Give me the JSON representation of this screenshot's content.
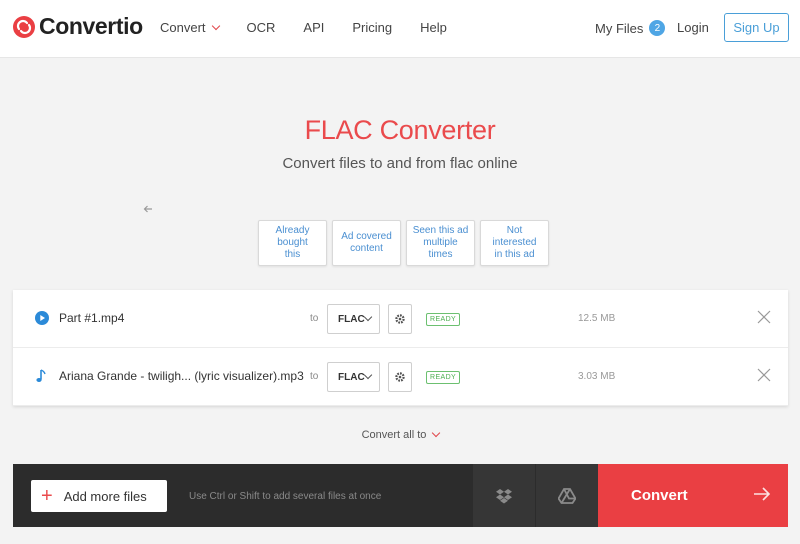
{
  "header": {
    "brand": "Convertio",
    "nav": [
      "Convert",
      "OCR",
      "API",
      "Pricing",
      "Help"
    ],
    "my_files": "My Files",
    "my_files_count": "2",
    "login": "Login",
    "signup": "Sign Up"
  },
  "hero": {
    "title": "FLAC Converter",
    "subtitle": "Convert files to and from flac online"
  },
  "ad_options": [
    {
      "line1": "Already bought",
      "line2": "this"
    },
    {
      "line1": "Ad covered",
      "line2": "content"
    },
    {
      "line1": "Seen this ad",
      "line2": "multiple times"
    },
    {
      "line1": "Not interested",
      "line2": "in this ad"
    }
  ],
  "files": [
    {
      "name": "Part #1.mp4",
      "to": "to",
      "format": "FLAC",
      "status": "READY",
      "size": "12.5 MB",
      "icon": "play-icon"
    },
    {
      "name": "Ariana Grande - twiligh... (lyric visualizer).mp3",
      "to": "to",
      "format": "FLAC",
      "status": "READY",
      "size": "3.03 MB",
      "icon": "music-note-icon"
    }
  ],
  "convert_all": "Convert all to",
  "bottom": {
    "add_files": "Add more files",
    "hint": "Use Ctrl or Shift to add several files at once",
    "convert": "Convert"
  },
  "colors": {
    "accent_red": "#ea4a4c",
    "link_blue": "#4a9fd8",
    "ready_green": "#4caf50",
    "bar_dark": "#2c2c2c"
  }
}
